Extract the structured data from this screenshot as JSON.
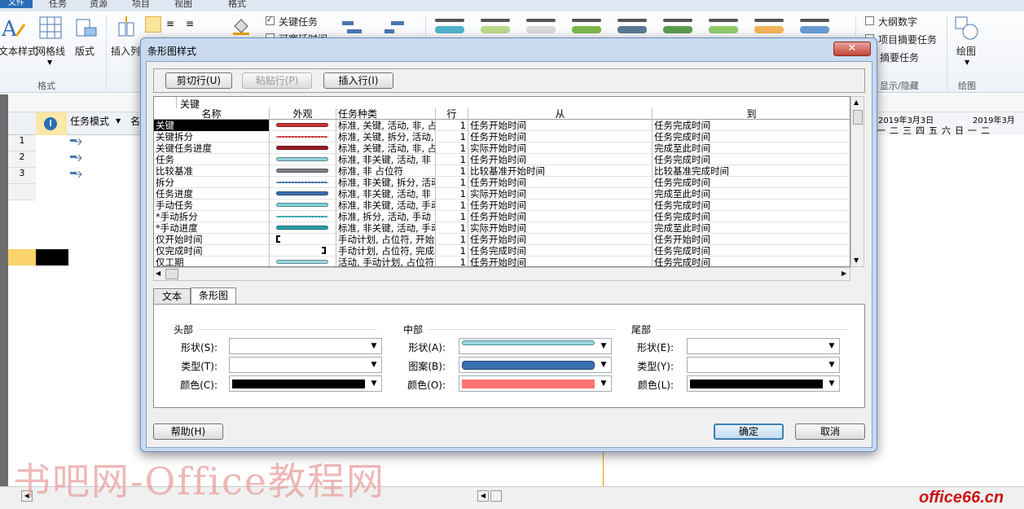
{
  "ribbon": {
    "tabs": [
      "文件",
      "任务",
      "资源",
      "项目",
      "视图",
      "格式"
    ],
    "buttons": {
      "text_styles": "文本样式",
      "gridlines": "网格线",
      "layout": "版式",
      "insert_column": "插入列"
    },
    "group_format": "格式",
    "checkboxes": {
      "critical_tasks": "关键任务",
      "slack": "可宽延时间",
      "outline_number": "大纲数字",
      "project_summary": "项目摘要任务",
      "summary_tasks": "摘要任务"
    },
    "group_show_hide": "显示/隐藏",
    "drawing": "绘图",
    "group_drawing": "绘图"
  },
  "sheet": {
    "column_task_mode": "任务模式",
    "column_name_partial": "名",
    "row_numbers": [
      "1",
      "2",
      "3"
    ],
    "timescale_1": "2019年3月3日",
    "timescale_2": "2019年3月",
    "days": [
      "一",
      "二",
      "三",
      "四",
      "五",
      "六",
      "日",
      "一",
      "二"
    ]
  },
  "dialog": {
    "title": "条形图样式",
    "close_icon_glyph": "✕",
    "toolbar": {
      "cut_row": "剪切行(U)",
      "paste_row": "粘贴行(P)",
      "insert_row": "插入行(I)"
    },
    "grid": {
      "edit_value": "关键",
      "headers": {
        "name": "名称",
        "appearance": "外观",
        "task_type": "任务种类",
        "row": "行",
        "from": "从",
        "to": "到"
      },
      "rows": [
        {
          "name": "关键",
          "bar": "#c8353b",
          "type": "标准, 关键, 活动, 非, 占",
          "row": "1",
          "from": "任务开始时间",
          "to": "任务完成时间"
        },
        {
          "name": "关键拆分",
          "bar": "dotted-red",
          "type": "标准, 关键, 拆分, 活动, 非",
          "row": "1",
          "from": "任务开始时间",
          "to": "任务完成时间"
        },
        {
          "name": "关键任务进度",
          "bar": "#9b1b22",
          "type": "标准, 关键, 活动, 非, 占",
          "row": "1",
          "from": "实际开始时间",
          "to": "完成至此时间"
        },
        {
          "name": "任务",
          "bar": "#8fd0d8",
          "type": "标准, 非关键, 活动, 非",
          "row": "1",
          "from": "任务开始时间",
          "to": "任务完成时间"
        },
        {
          "name": "比较基准",
          "bar": "#7d8288",
          "type": "标准, 非 占位符",
          "row": "1",
          "from": "比较基准开始时间",
          "to": "比较基准完成时间"
        },
        {
          "name": "拆分",
          "bar": "dotted-blue",
          "type": "标准, 非关键, 拆分, 活动",
          "row": "1",
          "from": "任务开始时间",
          "to": "任务完成时间"
        },
        {
          "name": "任务进度",
          "bar": "#3a6fb0",
          "type": "标准, 非关键, 活动, 非",
          "row": "1",
          "from": "实际开始时间",
          "to": "完成至此时间"
        },
        {
          "name": "手动任务",
          "bar": "#7fd3dc",
          "type": "标准, 非关键, 活动, 手动",
          "row": "1",
          "from": "任务开始时间",
          "to": "任务完成时间"
        },
        {
          "name": "*手动拆分",
          "bar": "dotted-teal",
          "type": "标准, 拆分, 活动, 手动",
          "row": "1",
          "from": "任务开始时间",
          "to": "任务完成时间"
        },
        {
          "name": "*手动进度",
          "bar": "#2aa3a8",
          "type": "标准, 非关键, 活动, 手动",
          "row": "1",
          "from": "实际开始时间",
          "to": "完成至此时间"
        },
        {
          "name": "仅开始时间",
          "bar": "start-bracket",
          "type": "手动计划, 占位符, 开始",
          "row": "1",
          "from": "任务开始时间",
          "to": "任务开始时间"
        },
        {
          "name": "仅完成时间",
          "bar": "end-bracket",
          "type": "手动计划, 占位符, 完成",
          "row": "1",
          "from": "任务完成时间",
          "to": "任务完成时间"
        },
        {
          "name": "仅工期",
          "bar": "#9fd8e0",
          "type": "活动, 手动计划, 占位符",
          "row": "1",
          "from": "任务开始时间",
          "to": "任务完成时间"
        }
      ]
    },
    "tabs": {
      "text": "文本",
      "bars": "条形图"
    },
    "sections": {
      "head": "头部",
      "middle": "中部",
      "tail": "尾部"
    },
    "labels": {
      "head_shape": "形状(S):",
      "head_type": "类型(T):",
      "head_color": "颜色(C):",
      "mid_shape": "形状(A):",
      "mid_pattern": "图案(B):",
      "mid_color": "颜色(O):",
      "tail_shape": "形状(E):",
      "tail_type": "类型(Y):",
      "tail_color": "颜色(L):"
    },
    "values": {
      "head_color": "#000000",
      "mid_shape_color": "#9fd8e0",
      "mid_pattern_color": "#3a6fb0",
      "mid_color": "#ff7373",
      "tail_color": "#000000"
    },
    "buttons": {
      "help": "帮助(H)",
      "ok": "确定",
      "cancel": "取消"
    }
  },
  "watermark": "书吧网-Office教程网",
  "brand": "office66.cn"
}
